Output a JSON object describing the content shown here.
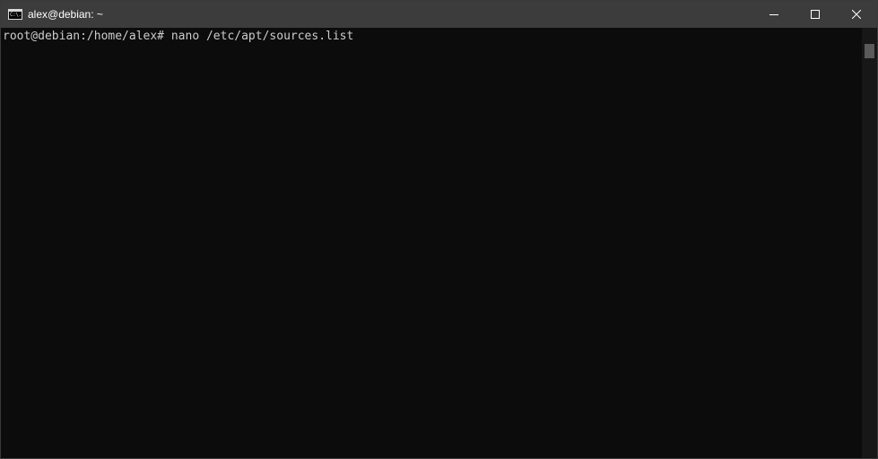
{
  "window": {
    "title": "alex@debian: ~",
    "icon": "console-icon",
    "icon_glyph": "C:\\."
  },
  "controls": {
    "minimize_icon": "minimize-icon",
    "maximize_icon": "maximize-icon",
    "close_icon": "close-icon"
  },
  "terminal": {
    "lines": [
      "root@debian:/home/alex# nano /etc/apt/sources.list"
    ],
    "foreground": "#cccccc",
    "background": "#0c0c0c"
  },
  "colors": {
    "titlebar": "#3c3c3c",
    "scrollbar_track": "#171717",
    "scrollbar_thumb": "#5a5a5a"
  }
}
